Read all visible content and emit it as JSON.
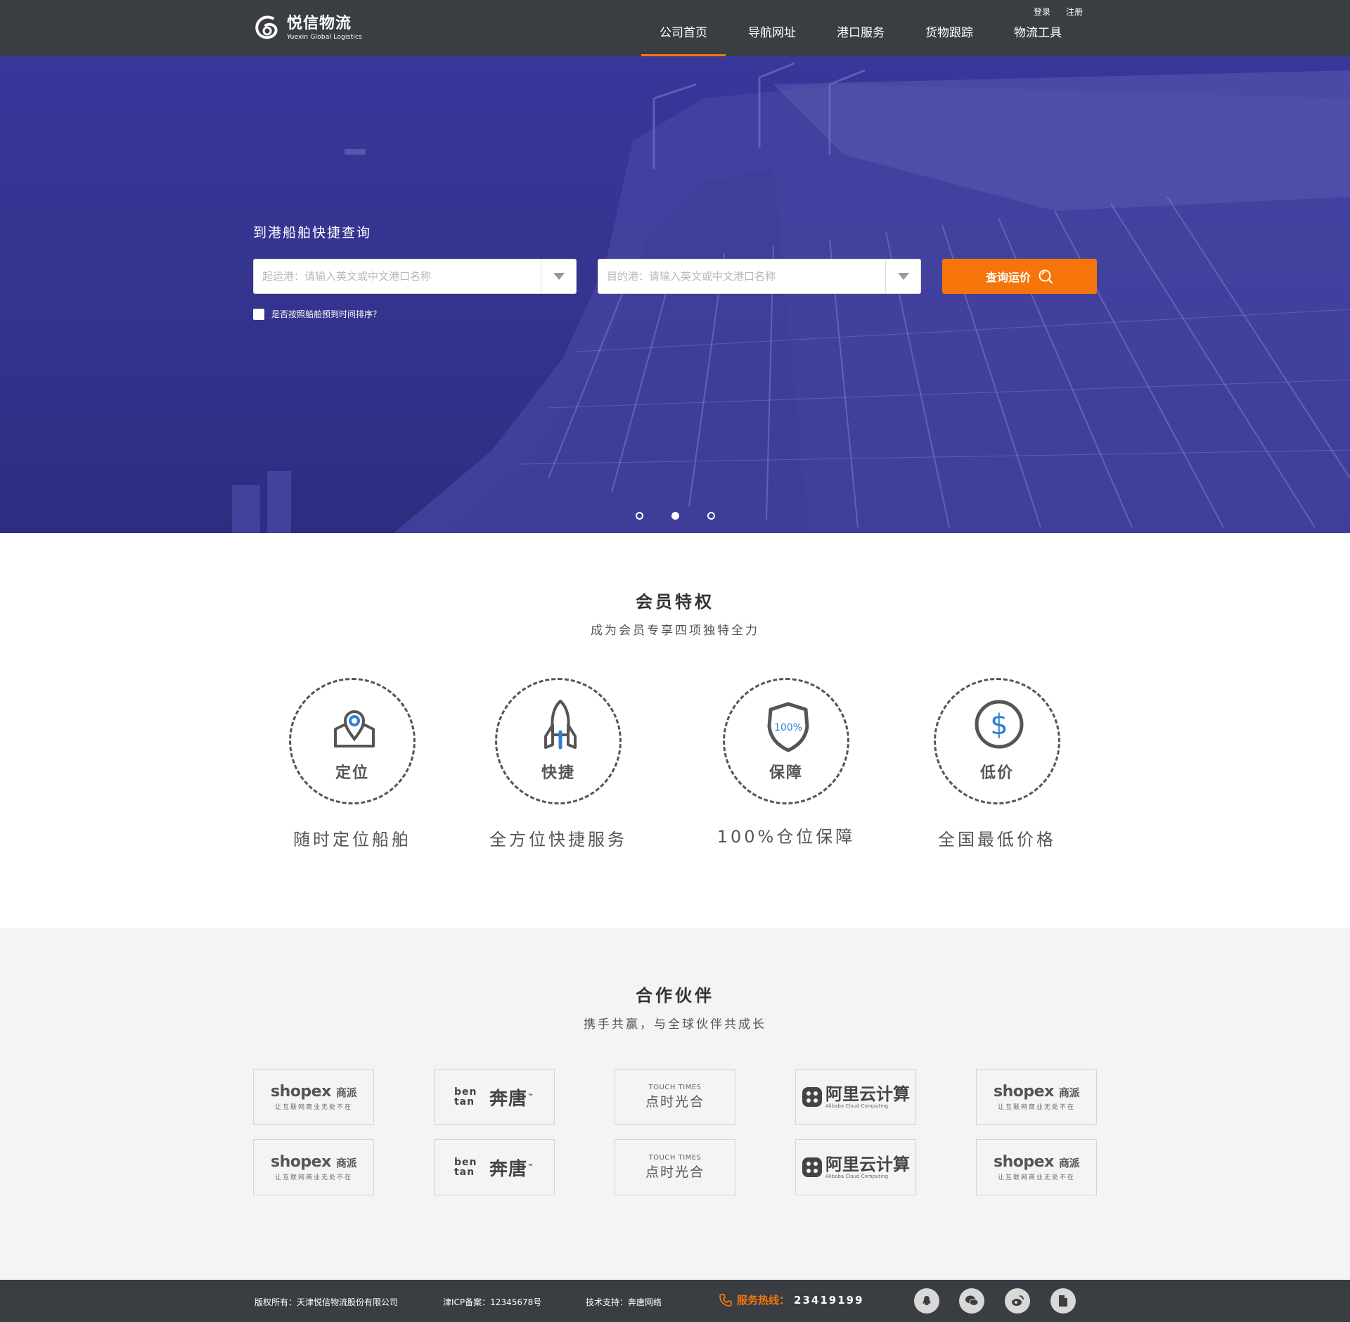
{
  "brand": {
    "name_cn": "悦信物流",
    "name_en": "Yuexin Global Logistics"
  },
  "top_links": {
    "login": "登录",
    "register": "注册"
  },
  "nav": [
    "公司首页",
    "导航网址",
    "港口服务",
    "货物跟踪",
    "物流工具"
  ],
  "hero": {
    "title": "到港船舶快捷查询",
    "origin_placeholder": "起运港：请输入英文或中文港口名称",
    "dest_placeholder": "目的港：请输入英文或中文港口名称",
    "query_button": "查询运价",
    "sort_label": "是否按照船舶预到时间排序？",
    "carousel_active_index": 1
  },
  "member": {
    "title": "会员特权",
    "subtitle": "成为会员专享四项独特全力",
    "features": [
      {
        "label": "定位",
        "desc": "随时定位船舶",
        "icon": "map-pin-icon"
      },
      {
        "label": "快捷",
        "desc": "全方位快捷服务",
        "icon": "rocket-icon"
      },
      {
        "label": "保障",
        "desc": "100%仓位保障",
        "icon": "shield-icon",
        "badge": "100%"
      },
      {
        "label": "低价",
        "desc": "全国最低价格",
        "icon": "dollar-icon",
        "symbol": "$"
      }
    ]
  },
  "partners": {
    "title": "合作伙伴",
    "subtitle": "携手共赢，与全球伙伴共成长",
    "shopex": {
      "name": "shopex",
      "cn": "商派",
      "slogan": "让互联网商业无处不在"
    },
    "bentang": {
      "mark": "ben tan",
      "cn": "奔唐",
      "tm": "™"
    },
    "touch": {
      "en": "TOUCH TIMES",
      "cn": "点时光合"
    },
    "ali": {
      "cn": "阿里云计算",
      "en": "Alibaba Cloud Computing"
    }
  },
  "footer": {
    "copyright": "版权所有：天津悦信物流股份有限公司",
    "icp": "津ICP备案：12345678号",
    "support": "技术支持：奔唐网络",
    "hotline_label": "服务热线：",
    "hotline_number": "23419199"
  },
  "colors": {
    "accent": "#f5750a",
    "header_bg": "#3a3e42",
    "hero_tint": "#35348f",
    "icon_blue": "#2c7fd6"
  }
}
